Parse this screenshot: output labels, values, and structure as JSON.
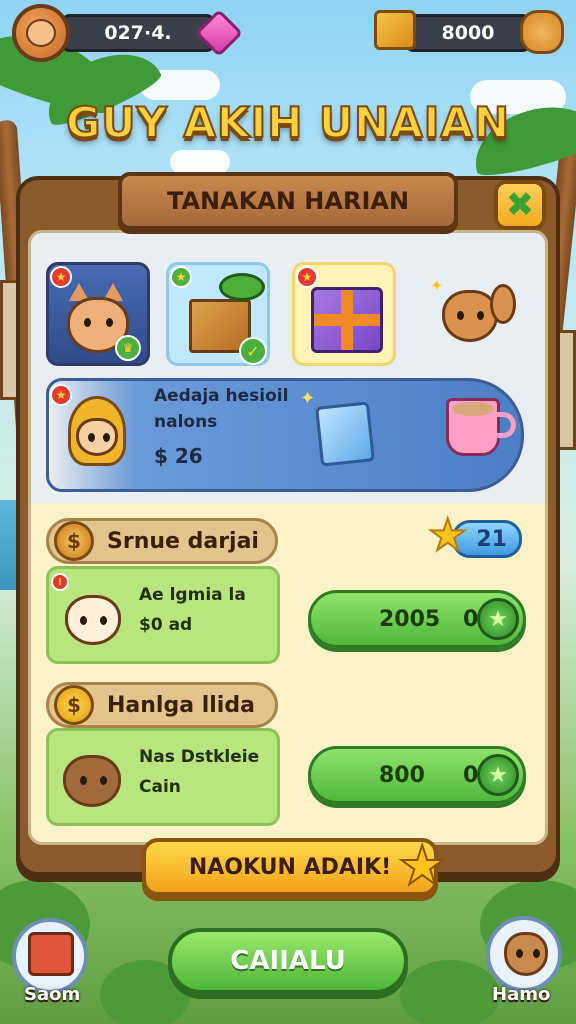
{
  "hud": {
    "left_value": "027·4.",
    "right_value": "8000"
  },
  "title": "GUY AKIH UNAIAN",
  "panel": {
    "header": "TANAKAN HARIAN",
    "close_icon": "x-icon"
  },
  "reward_slots": [
    {
      "icon": "cat-icon"
    },
    {
      "icon": "gift-box-icon"
    },
    {
      "icon": "present-icon"
    },
    {
      "icon": "squirrel-icon"
    }
  ],
  "banner": {
    "line1": "Aedaja hesioil",
    "line2": "nalons",
    "price": "$ 26"
  },
  "section1": {
    "label": "Srnue darjai",
    "score": "21",
    "item_line1": "Ae lgmia la",
    "item_line2": "$0 ad",
    "price": "2005",
    "zero": "0"
  },
  "section2": {
    "label": "Hanlga llida",
    "item_line1": "Nas Dstkleie",
    "item_line2": "Cain",
    "price": "800",
    "zero": "0"
  },
  "ribbon": "NAOKUN ADAIK!",
  "play_button": "CAIIALU",
  "corner_left": "Saom",
  "corner_right": "Hamo",
  "colors": {
    "accent_yellow": "#ffd23d",
    "wood": "#8a5a2b",
    "button_green": "#4fb73b",
    "banner_blue": "#4d7fc6"
  }
}
